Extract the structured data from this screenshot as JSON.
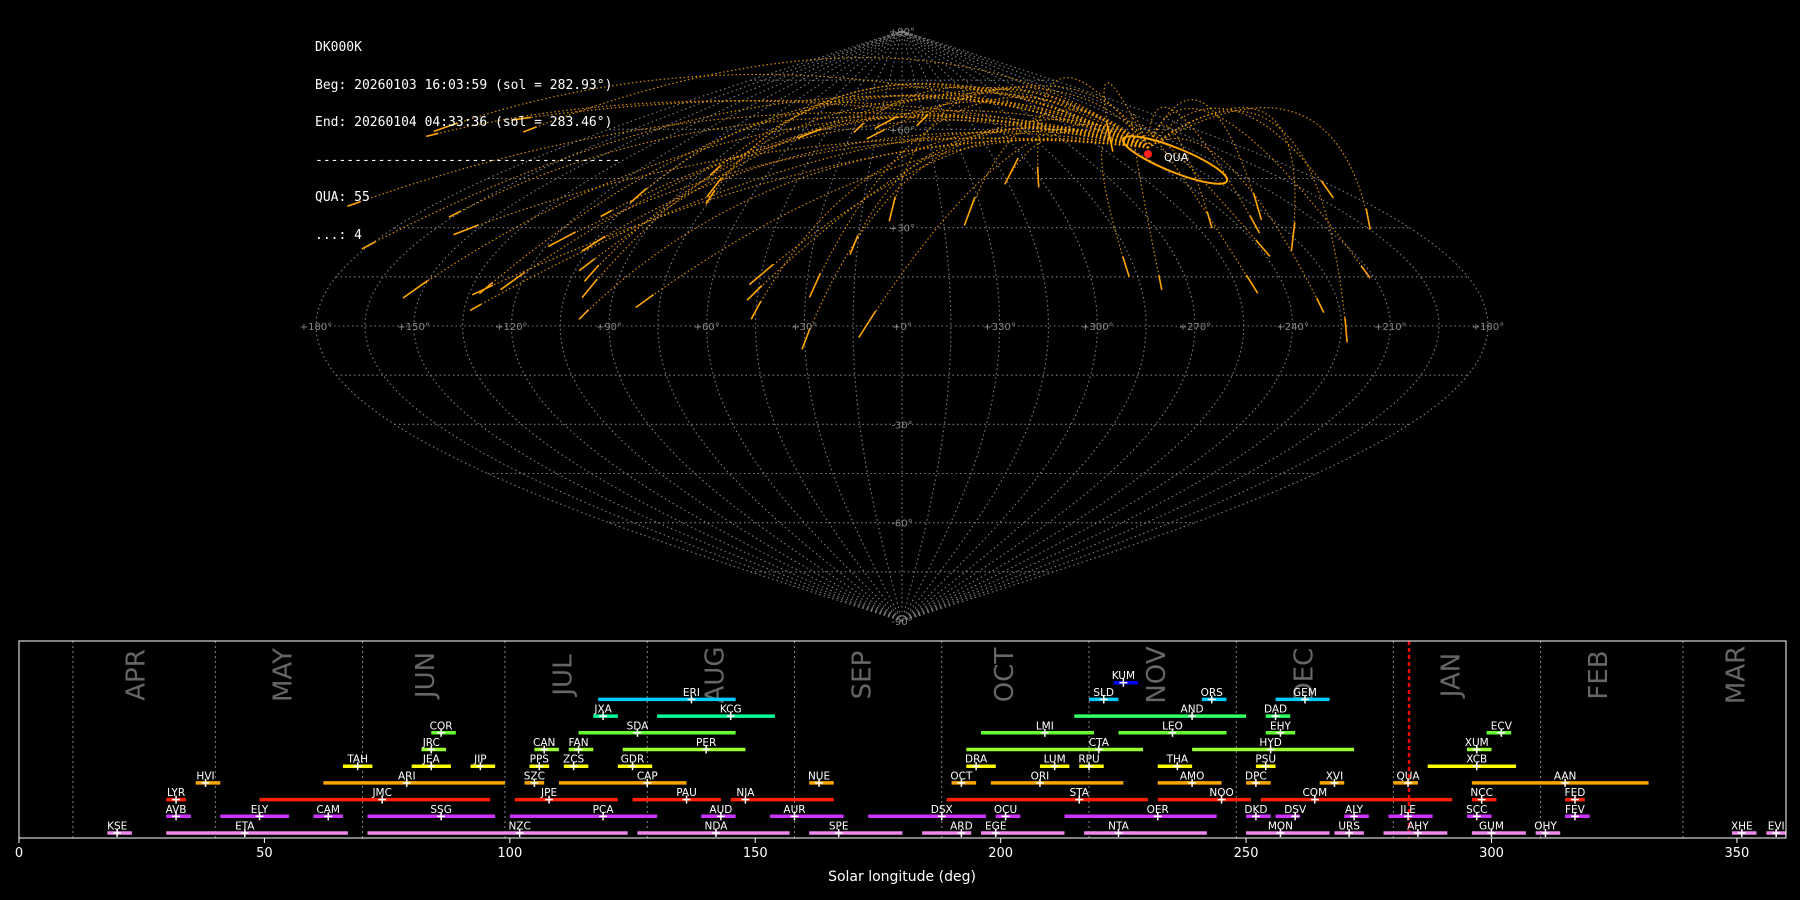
{
  "info": {
    "station": "DK000K",
    "begin": "Beg: 20260103 16:03:59 (sol = 282.93°)",
    "end": "End: 20260104 04:33:36 (sol = 283.46°)",
    "separator": "---------------------------------------",
    "counts": [
      "QUA: 55",
      "...: 4"
    ]
  },
  "colors": {
    "background": "#000000",
    "trail": "#ffa500",
    "radiant": "#ff2020",
    "grid": "#808080",
    "current_sol": "#ff0000",
    "frame": "#ffffff"
  },
  "sky_map": {
    "projection": "sinusoidal",
    "radiant_label": "QUA",
    "radiant": {
      "lon": 218,
      "lat": 50
    },
    "lon_labels": [
      "+180°",
      "+150°",
      "+120°",
      "+90°",
      "+60°",
      "+30°",
      "+0°",
      "+330°",
      "+300°",
      "+270°",
      "+240°",
      "+210°",
      "+180°"
    ],
    "lat_labels": [
      "+90°",
      "+60°",
      "+30°",
      "-30°",
      "-60°",
      "-90°"
    ]
  },
  "chart_data": {
    "type": "timeline",
    "title": "",
    "xlabel": "Solar longitude (deg)",
    "xlim": [
      0,
      360
    ],
    "xticks": [
      0,
      50,
      100,
      150,
      200,
      250,
      300,
      350
    ],
    "months": [
      {
        "name": "APR",
        "start": 11,
        "mid": 24
      },
      {
        "name": "MAY",
        "start": 40,
        "mid": 54
      },
      {
        "name": "JUN",
        "start": 70,
        "mid": 83
      },
      {
        "name": "JUL",
        "start": 99,
        "mid": 111
      },
      {
        "name": "AUG",
        "start": 128,
        "mid": 142
      },
      {
        "name": "SEP",
        "start": 158,
        "mid": 172
      },
      {
        "name": "OCT",
        "start": 188,
        "mid": 201
      },
      {
        "name": "NOV",
        "start": 218,
        "mid": 232
      },
      {
        "name": "DEC",
        "start": 248,
        "mid": 262
      },
      {
        "name": "JAN",
        "start": 280,
        "mid": 292
      },
      {
        "name": "FEB",
        "start": 310,
        "mid": 322
      },
      {
        "name": "MAR",
        "start": 339,
        "mid": 350
      }
    ],
    "current_sol": [
      282.93,
      283.46
    ],
    "showers": [
      {
        "code": "KUM",
        "start": 223,
        "end": 228,
        "peak": 225,
        "row": 10,
        "color": "#0000ff"
      },
      {
        "code": "ERI",
        "start": 118,
        "end": 146,
        "peak": 137,
        "row": 9,
        "color": "#00ccff"
      },
      {
        "code": "SLD",
        "start": 218,
        "end": 224,
        "peak": 221,
        "row": 9,
        "color": "#00ccff"
      },
      {
        "code": "ORS",
        "start": 241,
        "end": 246,
        "peak": 243,
        "row": 9,
        "color": "#00ccff"
      },
      {
        "code": "GEM",
        "start": 256,
        "end": 267,
        "peak": 262,
        "row": 9,
        "color": "#00ccff"
      },
      {
        "code": "JXA",
        "start": 117,
        "end": 122,
        "peak": 119,
        "row": 8,
        "color": "#00ff99"
      },
      {
        "code": "KCG",
        "start": 130,
        "end": 154,
        "peak": 145,
        "row": 8,
        "color": "#00ff99"
      },
      {
        "code": "AND",
        "start": 215,
        "end": 250,
        "peak": 239,
        "row": 8,
        "color": "#33ff66"
      },
      {
        "code": "DAD",
        "start": 254,
        "end": 259,
        "peak": 256,
        "row": 8,
        "color": "#33ff66"
      },
      {
        "code": "COR",
        "start": 84,
        "end": 89,
        "peak": 86,
        "row": 7,
        "color": "#66ff33"
      },
      {
        "code": "SDA",
        "start": 114,
        "end": 146,
        "peak": 126,
        "row": 7,
        "color": "#66ff33"
      },
      {
        "code": "LMI",
        "start": 196,
        "end": 219,
        "peak": 209,
        "row": 7,
        "color": "#66ff33"
      },
      {
        "code": "LEO",
        "start": 224,
        "end": 246,
        "peak": 235,
        "row": 7,
        "color": "#66ff33"
      },
      {
        "code": "EHY",
        "start": 254,
        "end": 260,
        "peak": 257,
        "row": 7,
        "color": "#66ff33"
      },
      {
        "code": "ECV",
        "start": 299,
        "end": 304,
        "peak": 302,
        "row": 7,
        "color": "#66ff33"
      },
      {
        "code": "JRC",
        "start": 82,
        "end": 87,
        "peak": 84,
        "row": 6,
        "color": "#99ff33"
      },
      {
        "code": "CAN",
        "start": 105,
        "end": 110,
        "peak": 107,
        "row": 6,
        "color": "#99ff33"
      },
      {
        "code": "FAN",
        "start": 112,
        "end": 117,
        "peak": 114,
        "row": 6,
        "color": "#99ff33"
      },
      {
        "code": "PER",
        "start": 123,
        "end": 148,
        "peak": 140,
        "row": 6,
        "color": "#99ff33"
      },
      {
        "code": "CTA",
        "start": 193,
        "end": 229,
        "peak": 220,
        "row": 6,
        "color": "#99ff33"
      },
      {
        "code": "HYD",
        "start": 239,
        "end": 272,
        "peak": 255,
        "row": 6,
        "color": "#99ff33"
      },
      {
        "code": "XUM",
        "start": 295,
        "end": 300,
        "peak": 297,
        "row": 6,
        "color": "#99ff33"
      },
      {
        "code": "TAH",
        "start": 66,
        "end": 72,
        "peak": 69,
        "row": 5,
        "color": "#ffff00"
      },
      {
        "code": "JEA",
        "start": 80,
        "end": 88,
        "peak": 84,
        "row": 5,
        "color": "#ffff00"
      },
      {
        "code": "JIP",
        "start": 92,
        "end": 97,
        "peak": 94,
        "row": 5,
        "color": "#ffff00"
      },
      {
        "code": "PPS",
        "start": 104,
        "end": 108,
        "peak": 106,
        "row": 5,
        "color": "#ffff00"
      },
      {
        "code": "ZCS",
        "start": 111,
        "end": 116,
        "peak": 113,
        "row": 5,
        "color": "#ffff00"
      },
      {
        "code": "GDR",
        "start": 122,
        "end": 129,
        "peak": 125,
        "row": 5,
        "color": "#ffff00"
      },
      {
        "code": "DRA",
        "start": 193,
        "end": 199,
        "peak": 195,
        "row": 5,
        "color": "#ffff00"
      },
      {
        "code": "LUM",
        "start": 208,
        "end": 214,
        "peak": 211,
        "row": 5,
        "color": "#ffff00"
      },
      {
        "code": "RPU",
        "start": 216,
        "end": 221,
        "peak": 218,
        "row": 5,
        "color": "#ffff00"
      },
      {
        "code": "THA",
        "start": 232,
        "end": 239,
        "peak": 236,
        "row": 5,
        "color": "#ffff00"
      },
      {
        "code": "PSU",
        "start": 252,
        "end": 256,
        "peak": 254,
        "row": 5,
        "color": "#ffff00"
      },
      {
        "code": "XCB",
        "start": 287,
        "end": 305,
        "peak": 297,
        "row": 5,
        "color": "#ffff00"
      },
      {
        "code": "HVI",
        "start": 36,
        "end": 41,
        "peak": 38,
        "row": 4,
        "color": "#ffa500"
      },
      {
        "code": "ARI",
        "start": 62,
        "end": 99,
        "peak": 79,
        "row": 4,
        "color": "#ffa500"
      },
      {
        "code": "SZC",
        "start": 103,
        "end": 107,
        "peak": 105,
        "row": 4,
        "color": "#ffa500"
      },
      {
        "code": "CAP",
        "start": 110,
        "end": 136,
        "peak": 128,
        "row": 4,
        "color": "#ffa500"
      },
      {
        "code": "NUE",
        "start": 161,
        "end": 166,
        "peak": 163,
        "row": 4,
        "color": "#ffa500"
      },
      {
        "code": "OCT",
        "start": 190,
        "end": 195,
        "peak": 192,
        "row": 4,
        "color": "#ffa500"
      },
      {
        "code": "ORI",
        "start": 198,
        "end": 225,
        "peak": 208,
        "row": 4,
        "color": "#ffa500"
      },
      {
        "code": "AMO",
        "start": 232,
        "end": 245,
        "peak": 239,
        "row": 4,
        "color": "#ffa500"
      },
      {
        "code": "DPC",
        "start": 250,
        "end": 255,
        "peak": 252,
        "row": 4,
        "color": "#ffa500"
      },
      {
        "code": "XVI",
        "start": 265,
        "end": 270,
        "peak": 268,
        "row": 4,
        "color": "#ffa500"
      },
      {
        "code": "QUA",
        "start": 280,
        "end": 285,
        "peak": 283,
        "row": 4,
        "color": "#ffa500"
      },
      {
        "code": "AAN",
        "start": 296,
        "end": 332,
        "peak": 315,
        "row": 4,
        "color": "#ffa500"
      },
      {
        "code": "LYR",
        "start": 30,
        "end": 34,
        "peak": 32,
        "row": 3,
        "color": "#ff2200"
      },
      {
        "code": "JMC",
        "start": 49,
        "end": 96,
        "peak": 74,
        "row": 3,
        "color": "#ff2200"
      },
      {
        "code": "JPE",
        "start": 101,
        "end": 122,
        "peak": 108,
        "row": 3,
        "color": "#ff2200"
      },
      {
        "code": "PAU",
        "start": 125,
        "end": 143,
        "peak": 136,
        "row": 3,
        "color": "#ff2200"
      },
      {
        "code": "NIA",
        "start": 145,
        "end": 166,
        "peak": 148,
        "row": 3,
        "color": "#ff2200"
      },
      {
        "code": "STA",
        "start": 189,
        "end": 230,
        "peak": 216,
        "row": 3,
        "color": "#ff2200"
      },
      {
        "code": "NOO",
        "start": 232,
        "end": 251,
        "peak": 245,
        "row": 3,
        "color": "#ff2200"
      },
      {
        "code": "COM",
        "start": 253,
        "end": 292,
        "peak": 264,
        "row": 3,
        "color": "#ff2200"
      },
      {
        "code": "NCC",
        "start": 296,
        "end": 301,
        "peak": 298,
        "row": 3,
        "color": "#ff2200"
      },
      {
        "code": "FED",
        "start": 315,
        "end": 319,
        "peak": 317,
        "row": 3,
        "color": "#ff2200"
      },
      {
        "code": "AVB",
        "start": 30,
        "end": 35,
        "peak": 32,
        "row": 2,
        "color": "#cc33ff"
      },
      {
        "code": "ELY",
        "start": 41,
        "end": 55,
        "peak": 49,
        "row": 2,
        "color": "#cc33ff"
      },
      {
        "code": "CAM",
        "start": 60,
        "end": 66,
        "peak": 63,
        "row": 2,
        "color": "#cc33ff"
      },
      {
        "code": "SSG",
        "start": 71,
        "end": 97,
        "peak": 86,
        "row": 2,
        "color": "#cc33ff"
      },
      {
        "code": "PCA",
        "start": 100,
        "end": 130,
        "peak": 119,
        "row": 2,
        "color": "#cc33ff"
      },
      {
        "code": "AUD",
        "start": 139,
        "end": 146,
        "peak": 143,
        "row": 2,
        "color": "#cc33ff"
      },
      {
        "code": "AUR",
        "start": 153,
        "end": 168,
        "peak": 158,
        "row": 2,
        "color": "#cc33ff"
      },
      {
        "code": "DSX",
        "start": 173,
        "end": 197,
        "peak": 188,
        "row": 2,
        "color": "#cc33ff"
      },
      {
        "code": "OCU",
        "start": 199,
        "end": 204,
        "peak": 201,
        "row": 2,
        "color": "#cc33ff"
      },
      {
        "code": "OER",
        "start": 213,
        "end": 244,
        "peak": 232,
        "row": 2,
        "color": "#cc33ff"
      },
      {
        "code": "DKD",
        "start": 250,
        "end": 255,
        "peak": 252,
        "row": 2,
        "color": "#cc33ff"
      },
      {
        "code": "DSV",
        "start": 256,
        "end": 261,
        "peak": 260,
        "row": 2,
        "color": "#cc33ff"
      },
      {
        "code": "ALY",
        "start": 270,
        "end": 275,
        "peak": 272,
        "row": 2,
        "color": "#cc33ff"
      },
      {
        "code": "JLE",
        "start": 279,
        "end": 288,
        "peak": 283,
        "row": 2,
        "color": "#cc33ff"
      },
      {
        "code": "SCC",
        "start": 295,
        "end": 300,
        "peak": 297,
        "row": 2,
        "color": "#cc33ff"
      },
      {
        "code": "FEV",
        "start": 315,
        "end": 320,
        "peak": 317,
        "row": 2,
        "color": "#cc33ff"
      },
      {
        "code": "KSE",
        "start": 18,
        "end": 23,
        "peak": 20,
        "row": 1,
        "color": "#ee88ee"
      },
      {
        "code": "ETA",
        "start": 30,
        "end": 67,
        "peak": 46,
        "row": 1,
        "color": "#ee88ee"
      },
      {
        "code": "NZC",
        "start": 71,
        "end": 124,
        "peak": 102,
        "row": 1,
        "color": "#ee88ee"
      },
      {
        "code": "NDA",
        "start": 126,
        "end": 157,
        "peak": 142,
        "row": 1,
        "color": "#ee88ee"
      },
      {
        "code": "SPE",
        "start": 161,
        "end": 180,
        "peak": 167,
        "row": 1,
        "color": "#ee88ee"
      },
      {
        "code": "ARD",
        "start": 184,
        "end": 194,
        "peak": 192,
        "row": 1,
        "color": "#ee88ee"
      },
      {
        "code": "EGE",
        "start": 196,
        "end": 213,
        "peak": 199,
        "row": 1,
        "color": "#ee88ee"
      },
      {
        "code": "NTA",
        "start": 217,
        "end": 242,
        "peak": 224,
        "row": 1,
        "color": "#ee88ee"
      },
      {
        "code": "MON",
        "start": 250,
        "end": 267,
        "peak": 257,
        "row": 1,
        "color": "#ee88ee"
      },
      {
        "code": "URS",
        "start": 268,
        "end": 274,
        "peak": 271,
        "row": 1,
        "color": "#ee88ee"
      },
      {
        "code": "AHY",
        "start": 278,
        "end": 291,
        "peak": 285,
        "row": 1,
        "color": "#ee88ee"
      },
      {
        "code": "GUM",
        "start": 296,
        "end": 307,
        "peak": 300,
        "row": 1,
        "color": "#ee88ee"
      },
      {
        "code": "OHY",
        "start": 309,
        "end": 314,
        "peak": 311,
        "row": 1,
        "color": "#ee88ee"
      },
      {
        "code": "XHE",
        "start": 349,
        "end": 354,
        "peak": 351,
        "row": 1,
        "color": "#ee88ee"
      },
      {
        "code": "EVI",
        "start": 356,
        "end": 361,
        "peak": 358,
        "row": 1,
        "color": "#ee88ee"
      }
    ]
  }
}
